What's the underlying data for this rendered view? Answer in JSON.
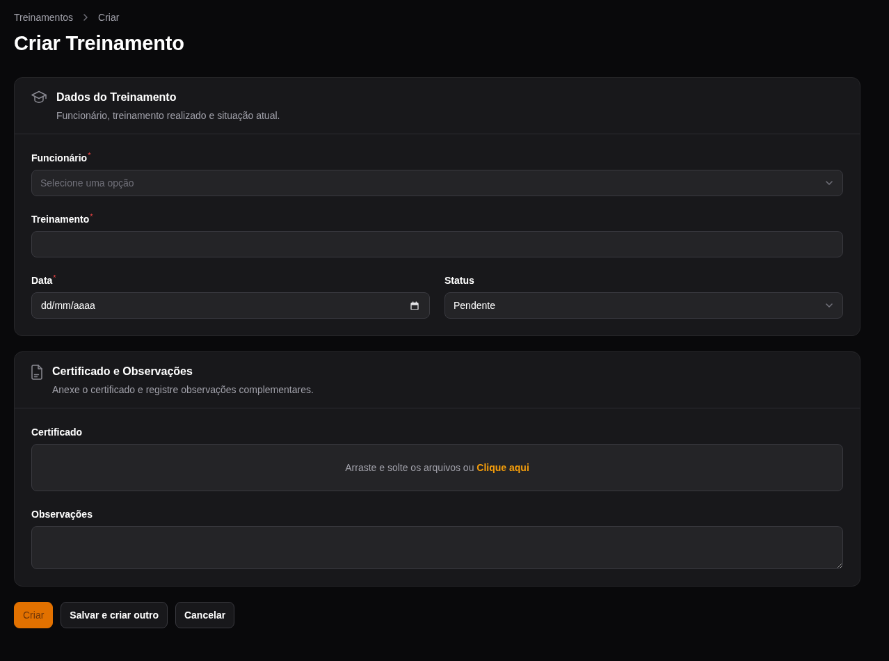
{
  "breadcrumb": [
    {
      "label": "Treinamentos"
    },
    {
      "label": "Criar"
    }
  ],
  "title": "Criar Treinamento",
  "sections": [
    {
      "title": "Dados do Treinamento",
      "subtitle": "Funcionário, treinamento realizado e situação atual.",
      "rows": [
        {
          "fields": [
            {
              "kind": "select",
              "label": "Funcionário",
              "required_mark": "*",
              "placeholder": "Selecione uma opção"
            }
          ]
        },
        {
          "fields": [
            {
              "kind": "text",
              "label": "Treinamento",
              "required_mark": "*"
            }
          ]
        },
        {
          "fields": [
            {
              "kind": "date",
              "label": "Data",
              "required_mark": "*",
              "placeholder": "dd/mm/aaaa"
            },
            {
              "kind": "select",
              "label": "Status",
              "value": "Pendente"
            }
          ]
        }
      ]
    },
    {
      "title": "Certificado e Observações",
      "subtitle": "Anexe o certificado e registre observações complementares.",
      "rows": [
        {
          "fields": [
            {
              "kind": "file",
              "label": "Certificado",
              "hint": "Arraste e solte os arquivos ou",
              "link": "Clique aqui"
            }
          ]
        },
        {
          "fields": [
            {
              "kind": "textarea",
              "label": "Observações"
            }
          ]
        }
      ]
    }
  ],
  "buttons": [
    {
      "label": "Criar",
      "kind": "primary"
    },
    {
      "label": "Salvar e criar outro",
      "kind": "secondary"
    },
    {
      "label": "Cancelar",
      "kind": "secondary"
    }
  ]
}
